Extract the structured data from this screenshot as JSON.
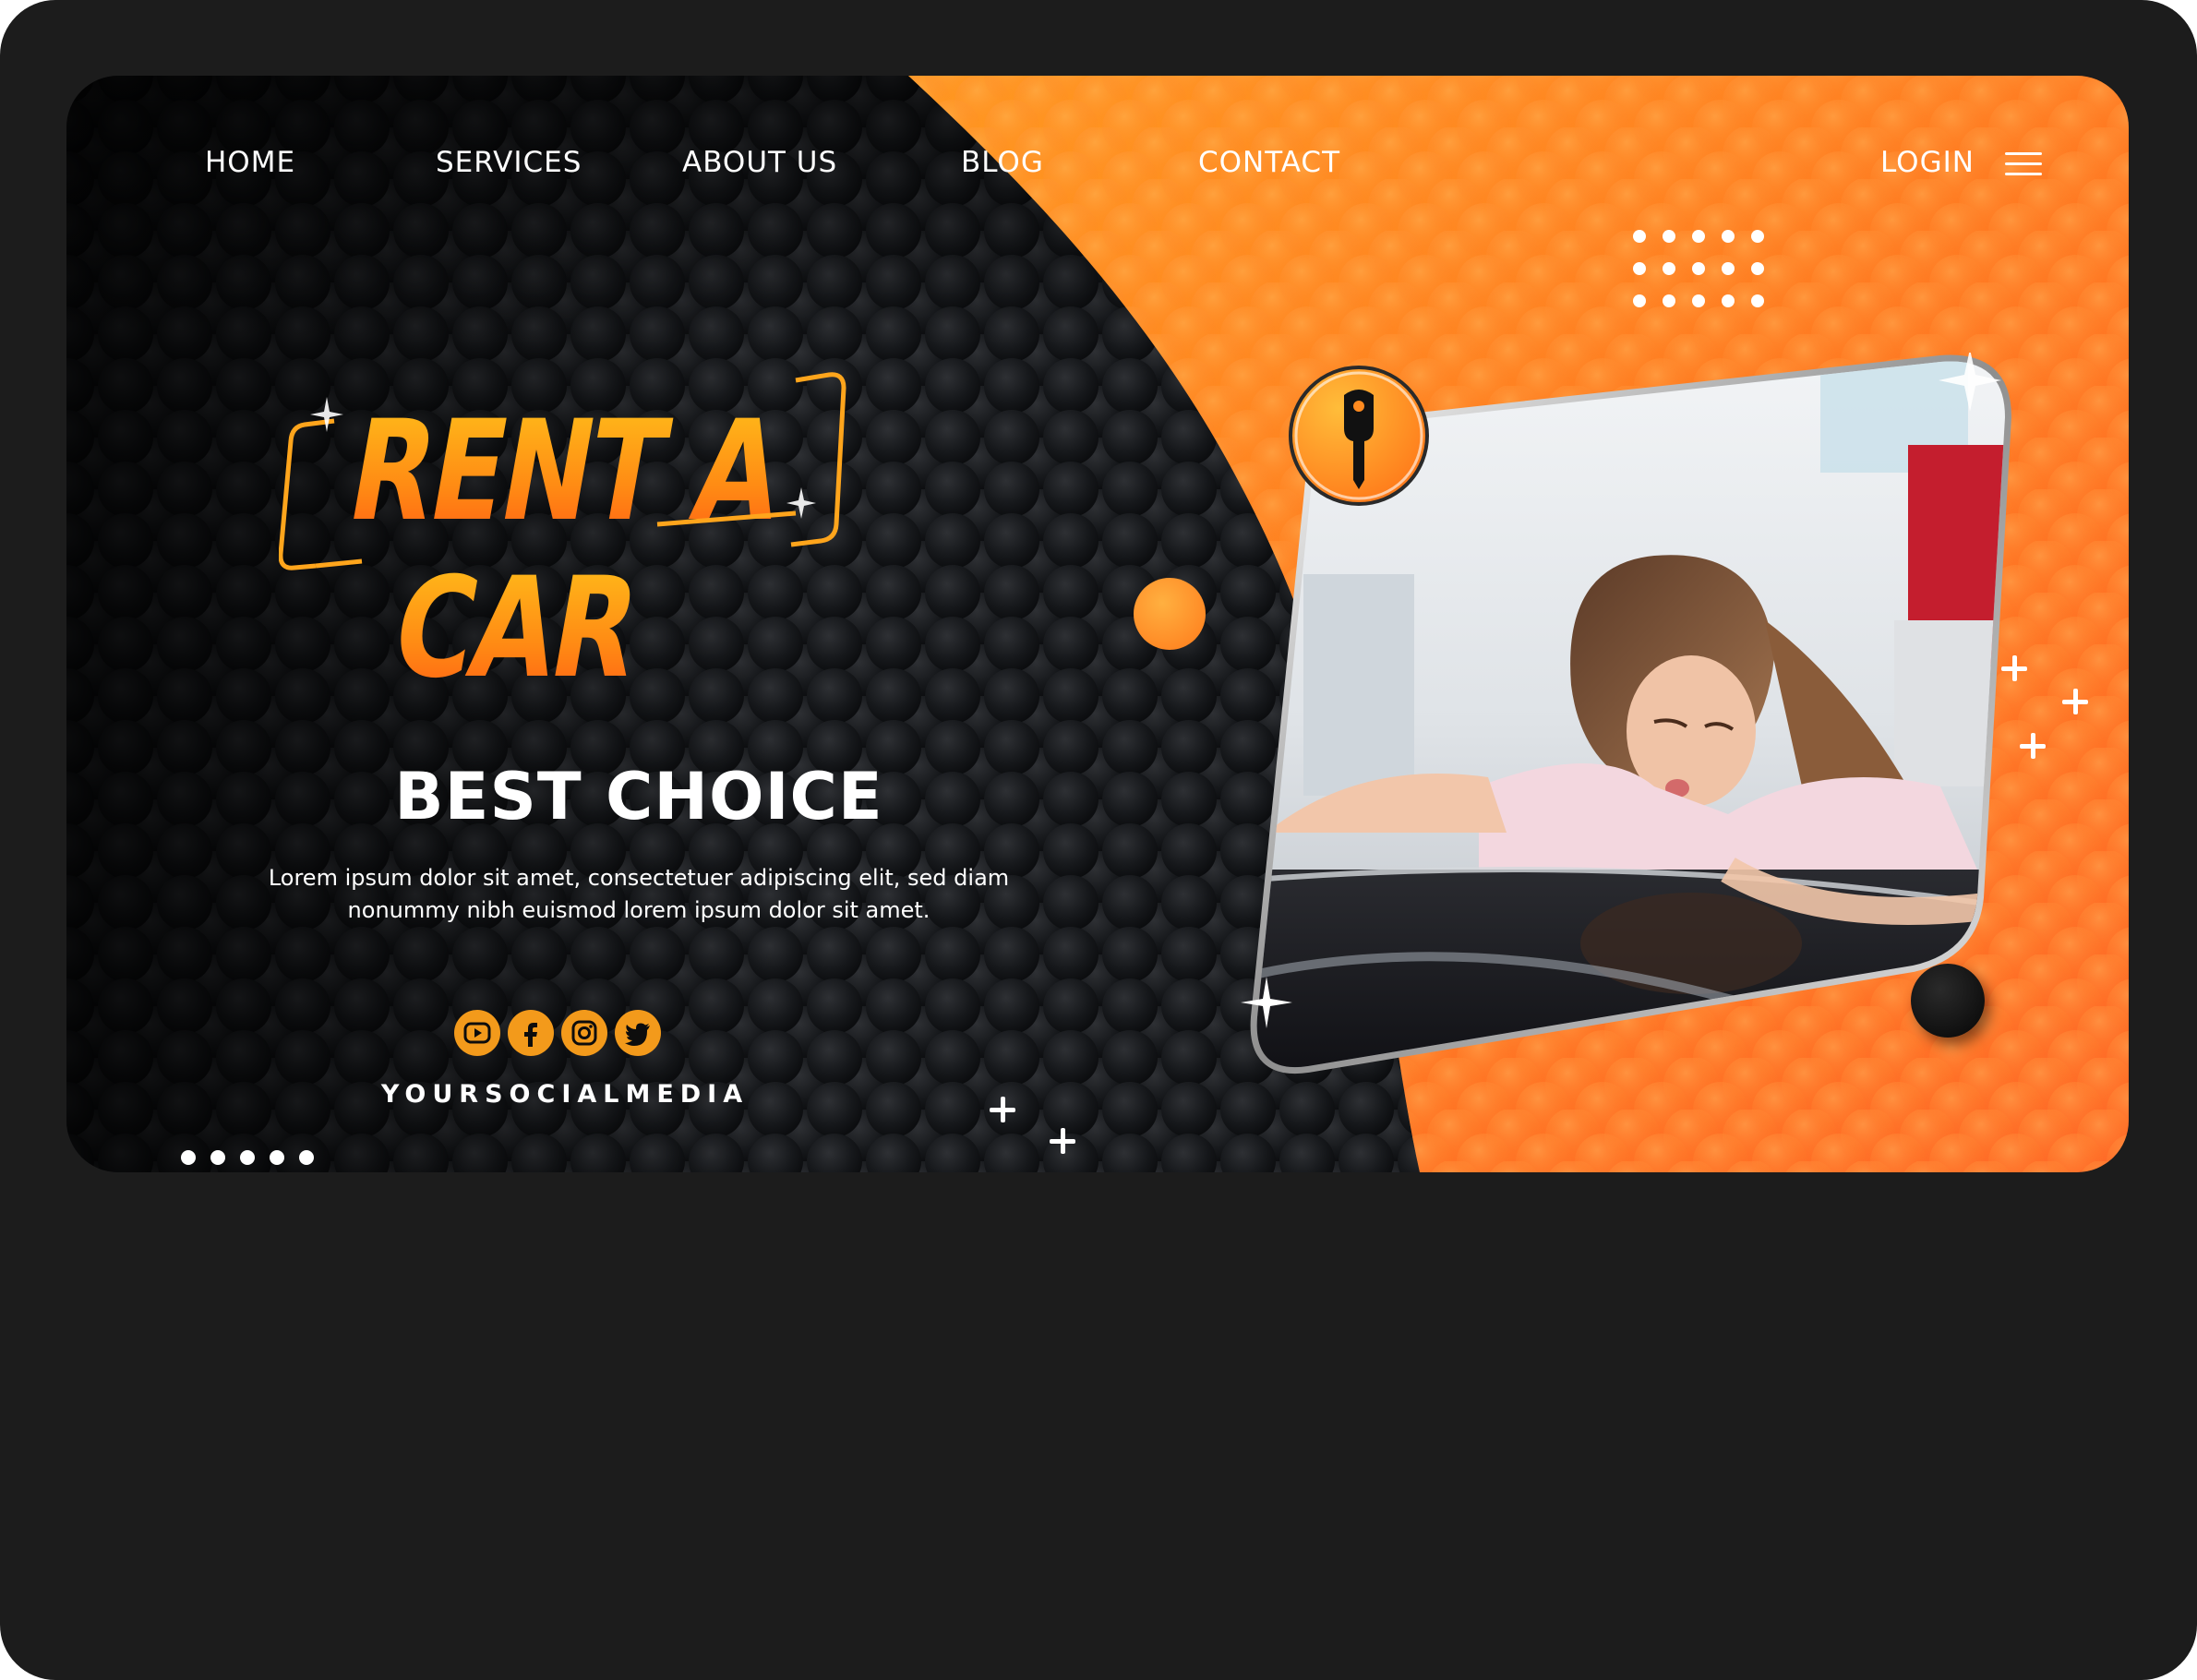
{
  "nav": {
    "items": [
      {
        "label": "HOME"
      },
      {
        "label": "SERVICES"
      },
      {
        "label": "ABOUT US"
      },
      {
        "label": "BLOG"
      },
      {
        "label": "CONTACT"
      }
    ],
    "login": "LOGIN",
    "menu_icon": "hamburger-menu-icon"
  },
  "hero": {
    "logo_line1": "RENT A",
    "logo_line2": "CAR",
    "headline": "BEST CHOICE",
    "body": "Lorem ipsum dolor sit amet, consectetuer adipiscing elit, sed diam nonummy nibh euismod lorem ipsum dolor sit amet."
  },
  "social": {
    "icons": [
      "youtube-icon",
      "facebook-icon",
      "instagram-icon",
      "twitter-icon"
    ],
    "label": "YOURSOCIALMEDIA"
  },
  "decor": {
    "key_icon": "car-key-icon",
    "photo": "woman-kissing-car-photo"
  },
  "colors": {
    "accent_orange": "#ff7a1a",
    "accent_yellow": "#ffa51c",
    "dark_bg": "#0d0e10",
    "device_frame": "#1c1c1c"
  }
}
